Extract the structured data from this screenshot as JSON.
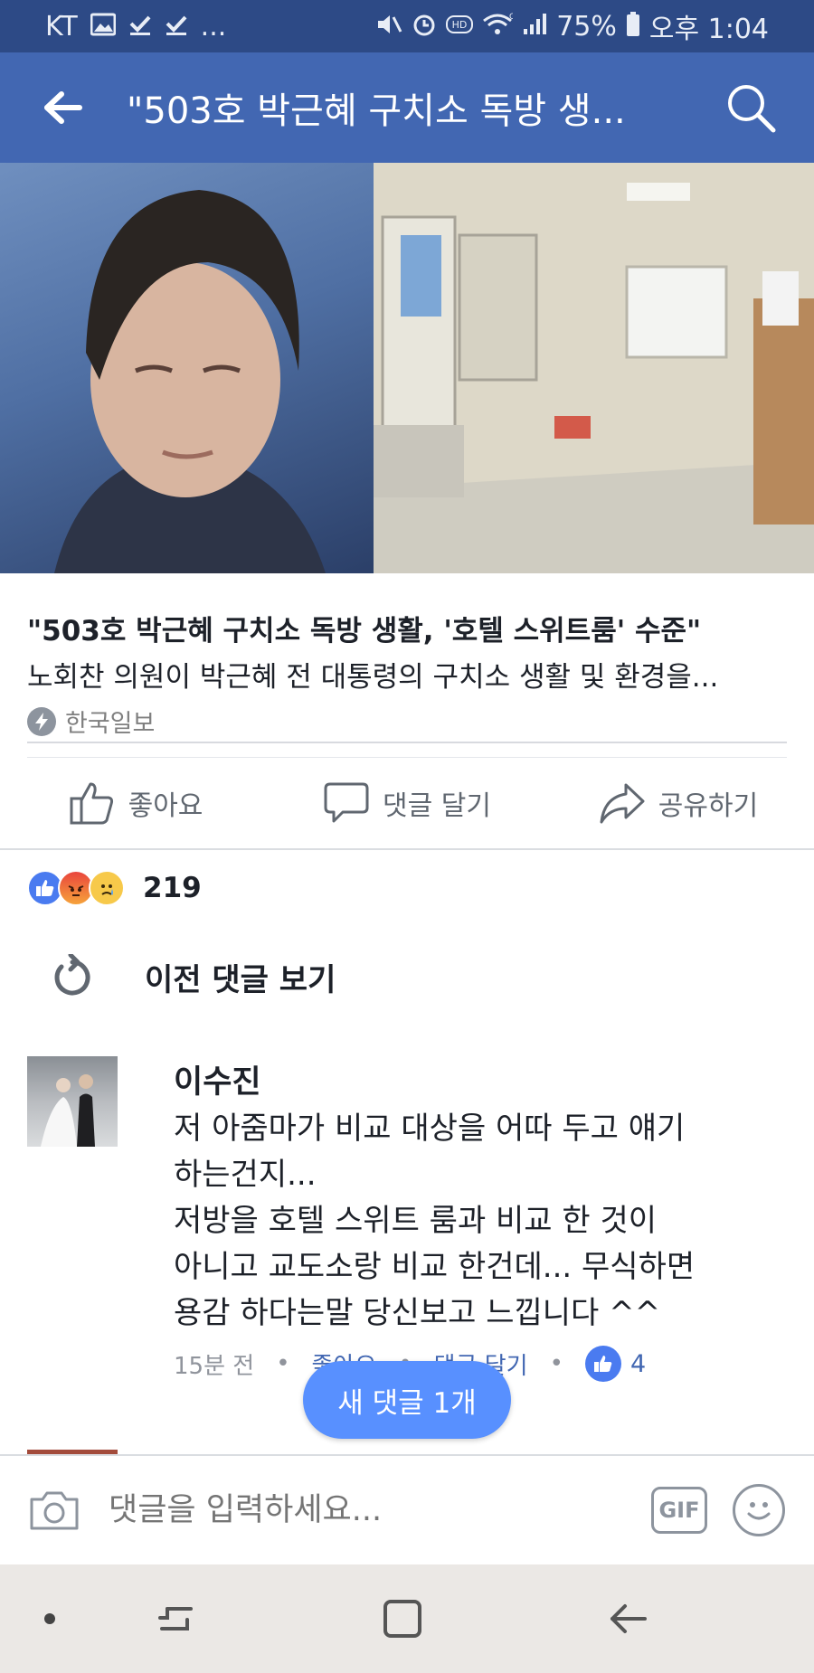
{
  "status_bar": {
    "carrier": "KT",
    "notification_icons": [
      "image-icon",
      "check-icon",
      "check-icon"
    ],
    "more": "...",
    "battery": "75%",
    "time": "오후 1:04",
    "network": "G"
  },
  "app_bar": {
    "title": "\"503호 박근혜 구치소 독방 생..."
  },
  "link_preview": {
    "title": "\"503호 박근혜 구치소 독방 생활, '호텔 스위트룸' 수준\"",
    "description": "노회찬 의원이 박근혜 전 대통령의 구치소 생활 및 환경을...",
    "source": "한국일보"
  },
  "actions": {
    "like": "좋아요",
    "comment": "댓글 달기",
    "share": "공유하기"
  },
  "reactions": {
    "types": [
      "like",
      "angry",
      "sad"
    ],
    "count": "219"
  },
  "previous_comments": {
    "label": "이전 댓글 보기"
  },
  "comment": {
    "author": "이수진",
    "text": "저 아줌마가 비교 대상을 어따 두고 얘기\n하는건지...\n저방을 호텔 스위트 룸과 비교 한 것이\n아니고 교도소랑 비교 한건데... 무식하면\n용감 하다는말 당신보고 느낍니다 ^^",
    "time": "15분 전",
    "like_label": "좋아요",
    "reply_label": "댓글 달기",
    "like_count": "4",
    "separator": "•"
  },
  "new_comment_pill": "새 댓글 1개",
  "input_bar": {
    "placeholder": "댓글을 입력하세요...",
    "gif_label": "GIF"
  }
}
